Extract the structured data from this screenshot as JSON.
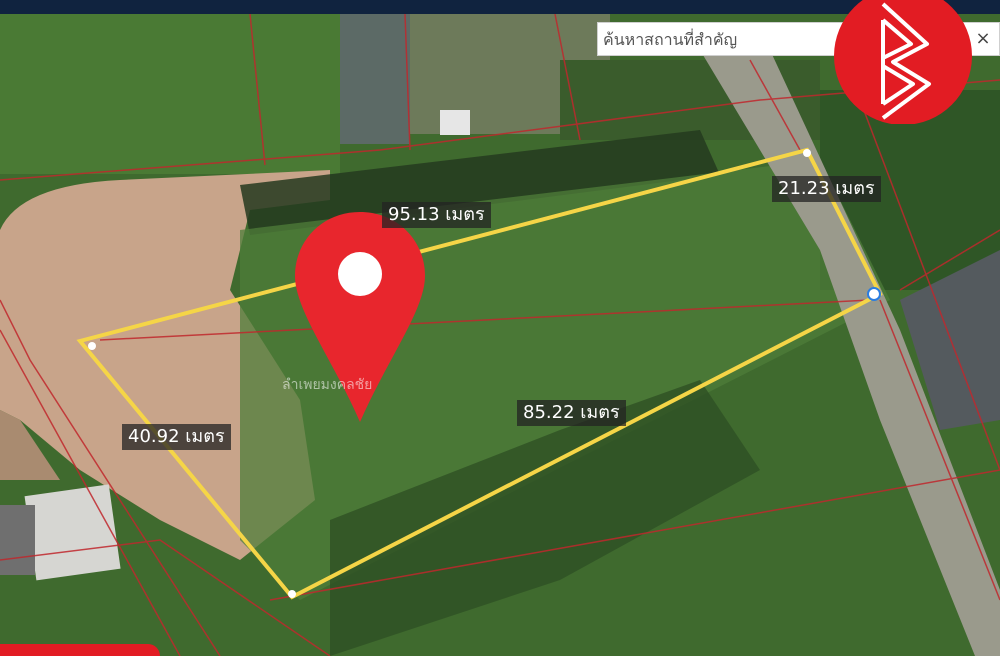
{
  "search": {
    "placeholder": "ค้นหาสถานที่สำคัญ",
    "close_glyph": "×"
  },
  "brand": {
    "logo_letter": "B",
    "color": "#e21c23"
  },
  "measurements": {
    "top": "95.13 เมตร",
    "right": "21.23 เมตร",
    "bottom": "85.22 เมตร",
    "left": "40.92 เมตร"
  },
  "poi_label": "ลำเพยมงคลชัย",
  "colors": {
    "boundary": "#f5d547",
    "parcel_lines": "#c0282d",
    "pin": "#e8262d"
  },
  "icons": [
    "location-pin-icon",
    "close-icon",
    "brand-logo-icon"
  ]
}
